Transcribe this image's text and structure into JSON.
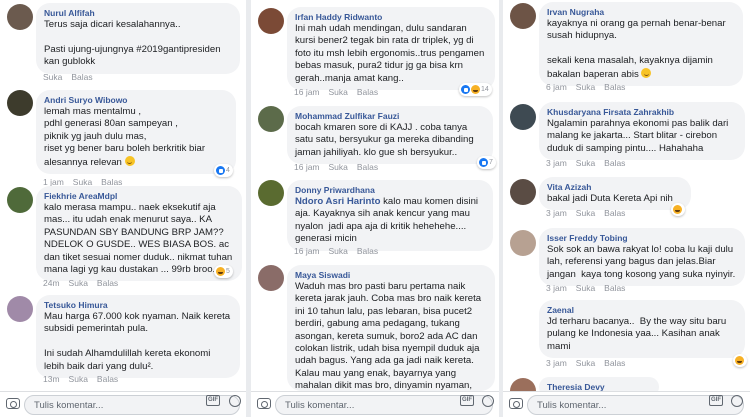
{
  "ui": {
    "like": "Suka",
    "reply": "Balas",
    "composer_placeholder": "Tulis komentar...",
    "gif": "GIF"
  },
  "col1": [
    {
      "name": "Nurul Alfifah",
      "text": "Terus saja dicari kesalahannya..\n\nPasti ujung-ujungnya #2019gantipresiden kan gublokk",
      "time": "",
      "count": ""
    },
    {
      "name": "Andri Suryo Wibowo",
      "text": "lemah mas mentalmu ,\npdhl generasi 80an sampeyan ,\npiknik yg jauh dulu mas,\nriset yg bener baru boleh berkritik biar alesannya relevan",
      "time": "1 jam",
      "count": "4"
    },
    {
      "name": "Fiekhrie AreaMdpl",
      "text": "kalo merasa mampu.. naek eksekutif aja mas... itu udah enak menurut saya.. KA PASUNDAN SBY BANDUNG BRP JAM??\nNDELOK O GUSDE.. WES BIASA BOS. ac dan tiket sesuai nomer duduk.. nikmat tuhan mana lagi yg kau dustakan ... 99rb broo....",
      "time": "24m",
      "count": "5"
    },
    {
      "name": "Tetsuko Himura",
      "text": "Mau harga 67.000 kok nyaman. Naik kereta subsidi pemerintah pula.\n\nIni sudah Alhamdulillah kereta ekonomi lebih baik dari yang dulu².",
      "time": "13m",
      "count": ""
    }
  ],
  "col2": [
    {
      "name": "Irfan Haddy Ridwanto",
      "text": "Ini mah udah mendingan, dulu sandaran kursi bener2 tegak bin rata dr triplek, yg di foto itu msh lebih ergonomis..trus pengamen bebas masuk, pura2 tidur jg ga bisa krn gerah..manja amat kang..",
      "time": "16 jam",
      "count": "14"
    },
    {
      "name": "Mohammad Zulfikar Fauzi",
      "text": "bocah kmaren sore di KAJJ . coba tanya satu satu, bersyukur ga mereka dibanding jaman jahiliyah. klo gue sh bersyukur..",
      "time": "16 jam",
      "count": "7"
    },
    {
      "name": "Donny Priwardhana",
      "mention": "Ndoro Asri Harinto",
      "text": " kalo mau komen disini aja. Kayaknya sih anak kencur yang mau nyalon  jadi apa aja di kritik hehehehe.... generasi micin",
      "time": "16 jam",
      "count": ""
    },
    {
      "name": "Maya Siswadi",
      "text": "Waduh mas bro pasti baru pertama naik kereta jarak jauh. Coba mas bro naik kereta ini 10 tahun lalu, pas lebaran, bisa pucet2 berdiri, gabung ama pedagang, tukang asongan, kereta sumuk, boro2 ada AC dan colokan listrik, udah bisa nyempil duduk aja udah bagus. Yang ada ga jadi naik kereta. Kalau mau yang enak, bayarnya yang mahalan dikit mas bro, dinyamin nyaman,",
      "time": "",
      "count": ""
    }
  ],
  "col3": [
    {
      "name": "Irvan Nugraha",
      "text": "kayaknya ni orang ga pernah benar-benar susah hidupnya.\n\nsekali kena masalah, kayaknya dijamin bakalan baperan abis",
      "time": "6 jam",
      "count": ""
    },
    {
      "name": "Khusdaryana Firsata Zahrakhib",
      "text": "Ngalamin parahnya ekonomi pas balik dari malang ke jakarta... Start blitar - cirebon duduk di samping pintu.... Hahahaha",
      "time": "3 jam",
      "count": ""
    },
    {
      "name": "Vita Azizah",
      "text": "bakal jadi Duta Kereta Api nih",
      "time": "3 jam",
      "count": ""
    },
    {
      "name": "Isser Freddy Tobing",
      "text": "Sok sok an bawa rakyat lo! coba lu kaji dulu lah, referensi yang bagus dan jelas.Biar jangan  kaya tong kosong yang suka nyinyir.",
      "time": "3 jam",
      "count": ""
    },
    {
      "name": "Zaenal",
      "text": "Jd terharu bacanya..  By the way situ baru pulang ke Indonesia yaa... Kasihan anak mami",
      "time": "3 jam",
      "count": ""
    },
    {
      "name": "Theresia Devy",
      "text": "",
      "time": "",
      "count": ""
    }
  ]
}
